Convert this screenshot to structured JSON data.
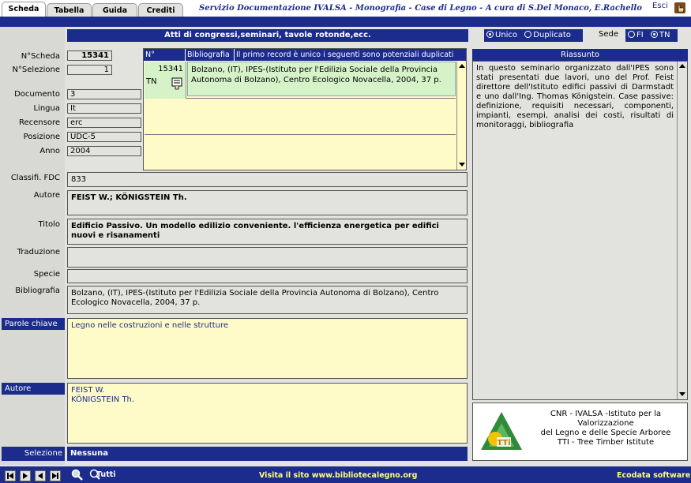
{
  "tabs": [
    {
      "label": "Scheda",
      "active": true
    },
    {
      "label": "Tabella",
      "active": false
    },
    {
      "label": "Guida",
      "active": false
    },
    {
      "label": "Crediti",
      "active": false
    }
  ],
  "app_title": "Servizio Documentazione IVALSA - Monografia - Case di Legno - A cura di S.Del Monaco, E.Rachello",
  "exit_label": "Esci",
  "record_type": "Atti di congressi,seminari, tavole rotonde,ecc.",
  "uniqueness": {
    "unico": "Unico",
    "duplicato": "Duplicato",
    "selected": "unico"
  },
  "sede": {
    "label": "Sede",
    "fi": "FI",
    "tn": "TN",
    "selected": "tn"
  },
  "fields": {
    "nscheda": {
      "label": "N°Scheda",
      "value": "15341"
    },
    "nselezione": {
      "label": "N°Selezione",
      "value": "1"
    },
    "documento": {
      "label": "Documento",
      "value": "3"
    },
    "lingua": {
      "label": "Lingua",
      "value": "It"
    },
    "recensore": {
      "label": "Recensore",
      "value": "erc"
    },
    "posizione": {
      "label": "Posizione",
      "value": "UDC-5"
    },
    "anno": {
      "label": "Anno",
      "value": "2004"
    },
    "classif": {
      "label": "Classifi. FDC",
      "value": "833"
    },
    "autore": {
      "label": "Autore",
      "value": "FEIST W.; KÖNIGSTEIN Th."
    },
    "titolo": {
      "label": "Titolo",
      "value": "Edificio Passivo. Un modello edilizio conveniente. l'efficienza energetica per edifici nuovi e risanamenti"
    },
    "traduzione": {
      "label": "Traduzione",
      "value": ""
    },
    "specie": {
      "label": "Specie",
      "value": ""
    },
    "bibliografia": {
      "label": "Bibliografia",
      "value": "Bolzano, (IT), IPES-(Istituto per l'Edilizia Sociale della Provincia Autonoma di Bolzano), Centro Ecologico Novacella,  2004, 37 p."
    }
  },
  "portal": {
    "headers": [
      "N°",
      "Bibliografia",
      "Il primo record è unico i seguenti sono potenziali duplicati"
    ],
    "rows": [
      {
        "num": "15341",
        "sede": "TN",
        "text": "Bolzano, (IT), IPES-(Istituto per l'Edilizia Sociale della Provincia Autonoma di Bolzano), Centro Ecologico Novacella,  2004, 37 p."
      }
    ]
  },
  "parole_chiave": {
    "label": "Parole chiave",
    "value": "Legno nelle costruzioni e nelle strutture"
  },
  "autore_list": {
    "label": "Autore",
    "values": [
      "FEIST W.",
      "KÖNIGSTEIN Th."
    ]
  },
  "riassunto": {
    "label": "Riassunto",
    "text": "In questo seminario organizzato dall'IPES sono stati presentati due lavori, uno del Prof. Feist direttore dell'Istituto edifici passivi di Darmstadt e uno dall'Ing. Thomas Königstein. Case passive: definizione, requisiti necessari, componenti, impianti, esempi, analisi dei costi, risultati di monitoraggi, bibliografia"
  },
  "institute": {
    "lines": [
      "CNR - IVALSA -Istituto per la Valorizzazione",
      "del Legno e delle Specie Arboree",
      "TTI - Tree Timber Istitute"
    ],
    "logo_text": "TTi"
  },
  "selezione": {
    "label": "Selezione",
    "value": "Nessuna"
  },
  "bottom": {
    "tutti": "Tutti",
    "site_link": "Visita il sito www.bibliotecalegno.org",
    "vendor": "Ecodata software"
  },
  "colors": {
    "navy": "#1c2c8c",
    "yellow": "#fffbc8",
    "green": "#d6f2c8",
    "gray": "#e2e2de"
  }
}
